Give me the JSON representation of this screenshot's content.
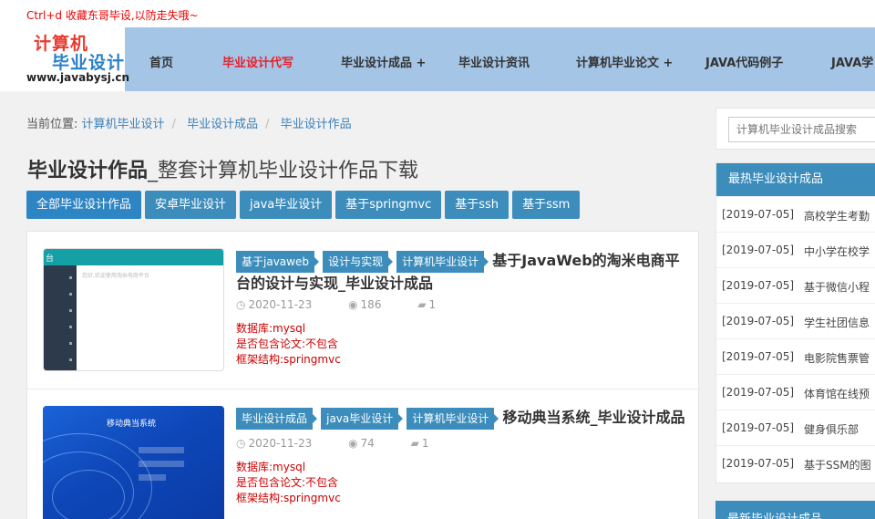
{
  "notice": "Ctrl+d 收藏东哥毕设,以防走失哦~",
  "logo": {
    "line1": "计算机",
    "line2": "毕业设计",
    "line3": "www.javabysj.cn"
  },
  "nav": [
    "首页",
    "毕业设计代写",
    "毕业设计成品 +",
    "毕业设计资讯",
    "计算机毕业论文 +",
    "JAVA代码例子",
    "JAVA学"
  ],
  "breadcrumb": {
    "prefix": "当前位置:",
    "items": [
      "计算机毕业设计",
      "毕业设计成品",
      "毕业设计作品"
    ]
  },
  "page_title": {
    "main": "毕业设计作品",
    "sub": "_整套计算机毕业设计作品下载"
  },
  "filters": [
    "全部毕业设计作品",
    "安卓毕业设计",
    "java毕业设计",
    "基于springmvc",
    "基于ssh",
    "基于ssm"
  ],
  "articles": [
    {
      "tags": [
        "基于javaweb",
        "设计与实现",
        "计算机毕业设计"
      ],
      "title_a": "基于JavaWeb的淘米电商平",
      "title_b": "台的设计与实现_毕业设计成品",
      "date": "2020-11-23",
      "views": "186",
      "comments": "1",
      "db": "数据库:mysql",
      "thesis": "是否包含论文:不包含",
      "framework": "框架结构:springmvc",
      "thumb_header": "台",
      "thumb_line": "您好,欢迎使用淘米电商平台"
    },
    {
      "tags": [
        "毕业设计成品",
        "java毕业设计",
        "计算机毕业设计"
      ],
      "title_a": "移动典当系统_毕业设计成品",
      "date": "2020-11-23",
      "views": "74",
      "comments": "1",
      "db": "数据库:mysql",
      "thesis": "是否包含论文:不包含",
      "framework": "框架结构:springmvc",
      "thumb_header": "移动典当系统"
    }
  ],
  "search": {
    "placeholder": "计算机毕业设计成品搜索"
  },
  "hot": {
    "title": "最热毕业设计成品",
    "items": [
      {
        "date": "[2019-07-05]",
        "title": "高校学生考勤"
      },
      {
        "date": "[2019-07-05]",
        "title": "中小学在校学"
      },
      {
        "date": "[2019-07-05]",
        "title": "基于微信小程"
      },
      {
        "date": "[2019-07-05]",
        "title": "学生社团信息"
      },
      {
        "date": "[2019-07-05]",
        "title": "电影院售票管"
      },
      {
        "date": "[2019-07-05]",
        "title": "体育馆在线预"
      },
      {
        "date": "[2019-07-05]",
        "title": "健身俱乐部"
      },
      {
        "date": "[2019-07-05]",
        "title": "基于SSM的图"
      }
    ]
  },
  "newest": {
    "title": "最新毕业设计成品"
  },
  "colors": {
    "accent": "#3c8dbc",
    "nav_bg": "#a4c5e6",
    "nav_active": "#e8202a",
    "notice": "#ee0000"
  }
}
